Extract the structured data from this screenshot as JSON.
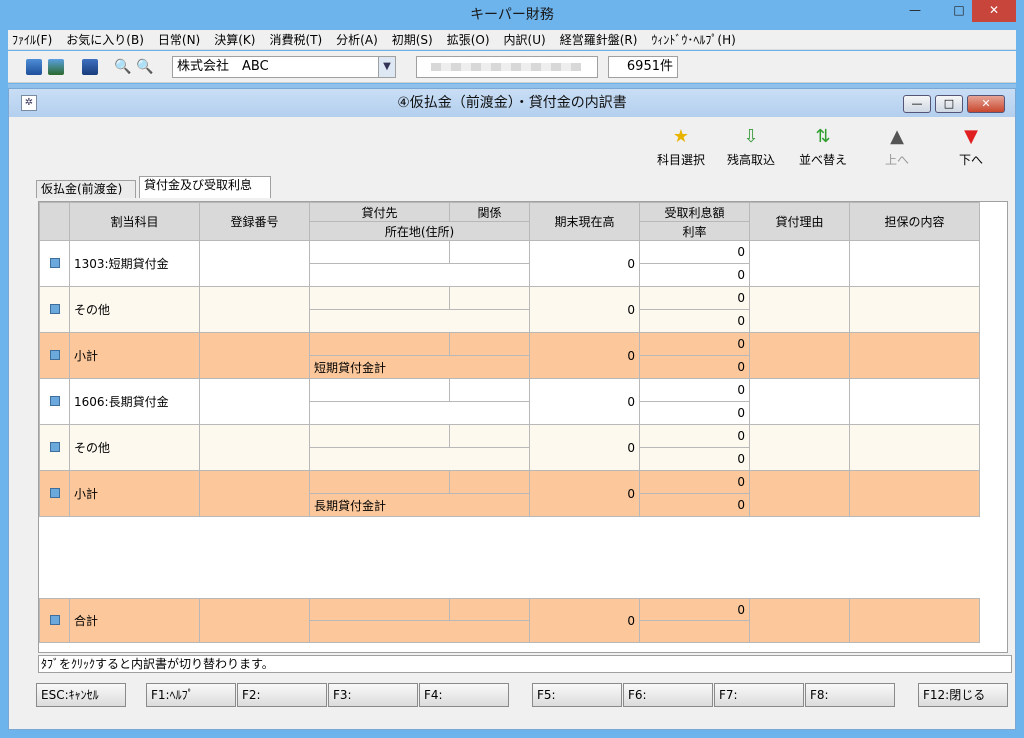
{
  "app": {
    "title": "キーパー財務"
  },
  "menu": [
    "ﾌｧｲﾙ(F)",
    "お気に入り(B)",
    "日常(N)",
    "決算(K)",
    "消費税(T)",
    "分析(A)",
    "初期(S)",
    "拡張(O)",
    "内訳(U)",
    "経営羅針盤(R)",
    "ｳｨﾝﾄﾞｳ･ﾍﾙﾌﾟ(H)"
  ],
  "toolbar": {
    "company": "株式会社　ABC",
    "count": "6951件"
  },
  "child": {
    "title": "④仮払金（前渡金）・貸付金の内訳書"
  },
  "actions": [
    {
      "label": "科目選択",
      "icon": "star-icon",
      "color": "#e8b400"
    },
    {
      "label": "残高取込",
      "icon": "import-icon",
      "color": "#3a9a3a"
    },
    {
      "label": "並べ替え",
      "icon": "sort-icon",
      "color": "#2e9e2e"
    },
    {
      "label": "上へ",
      "icon": "up-arrow-icon",
      "color": "#555555"
    },
    {
      "label": "下へ",
      "icon": "down-arrow-icon",
      "color": "#e02020"
    }
  ],
  "tabs": [
    "仮払金(前渡金)",
    "貸付金及び受取利息"
  ],
  "table": {
    "headers": {
      "col_kamoku": "割当科目",
      "col_toroku": "登録番号",
      "col_kashitsuke": "貸付先",
      "col_kankei": "関係",
      "col_shozaichi": "所在地(住所)",
      "col_kimatsu": "期末現在高",
      "col_uketori": "受取利息額",
      "col_riritsu": "利率",
      "col_riyu": "貸付理由",
      "col_tanpo": "担保の内容"
    },
    "rows": [
      {
        "label": "1303:短期貸付金",
        "sub": "",
        "balance": "0",
        "interest": "0",
        "rate": "0"
      },
      {
        "label": "その他",
        "sub": "",
        "balance": "0",
        "interest": "0",
        "rate": "0"
      },
      {
        "label": "小計",
        "sub": "短期貸付金計",
        "balance": "0",
        "interest": "0",
        "rate": "0"
      },
      {
        "label": "1606:長期貸付金",
        "sub": "",
        "balance": "0",
        "interest": "0",
        "rate": "0"
      },
      {
        "label": "その他",
        "sub": "",
        "balance": "0",
        "interest": "0",
        "rate": "0"
      },
      {
        "label": "小計",
        "sub": "長期貸付金計",
        "balance": "0",
        "interest": "0",
        "rate": "0"
      }
    ],
    "total": {
      "label": "合計",
      "balance": "0",
      "interest": "0"
    }
  },
  "status": "ﾀﾌﾞをｸﾘｯｸすると内訳書が切り替わります。",
  "fkeys": [
    "ESC:ｷｬﾝｾﾙ",
    "F1:ﾍﾙﾌﾟ",
    "F2:",
    "F3:",
    "F4:",
    "F5:",
    "F6:",
    "F7:",
    "F8:",
    "F12:閉じる"
  ]
}
